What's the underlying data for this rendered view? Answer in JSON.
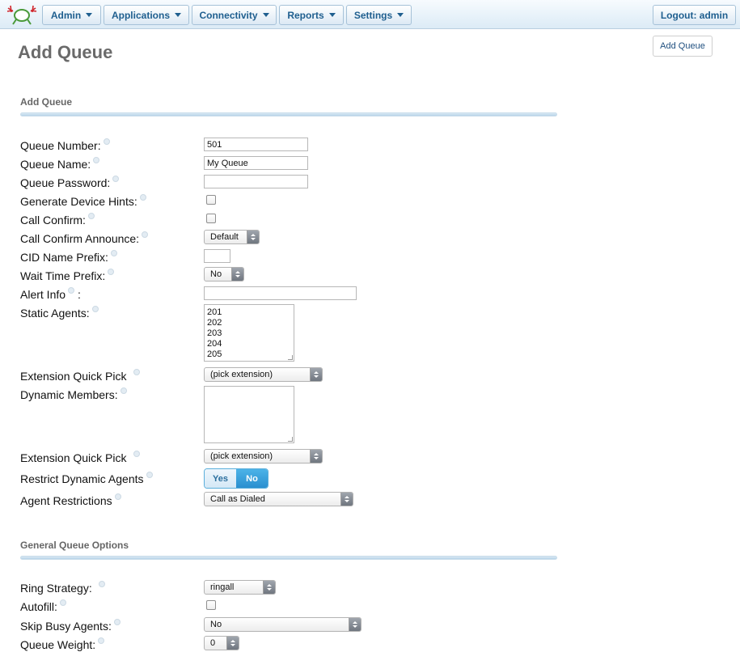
{
  "nav": {
    "menus": [
      "Admin",
      "Applications",
      "Connectivity",
      "Reports",
      "Settings"
    ],
    "logout": "Logout: admin"
  },
  "page": {
    "title": "Add Queue",
    "action_button": "Add Queue"
  },
  "sections": {
    "add_queue": "Add Queue",
    "general_options": "General Queue Options"
  },
  "fields": {
    "queue_number": {
      "label": "Queue Number:",
      "value": "501"
    },
    "queue_name": {
      "label": "Queue Name:",
      "value": "My Queue"
    },
    "queue_password": {
      "label": "Queue Password:",
      "value": ""
    },
    "device_hints": {
      "label": "Generate Device Hints:"
    },
    "call_confirm": {
      "label": "Call Confirm:"
    },
    "call_confirm_announce": {
      "label": "Call Confirm Announce:",
      "value": "Default"
    },
    "cid_prefix": {
      "label": "CID Name Prefix:",
      "value": ""
    },
    "wait_time_prefix": {
      "label": "Wait Time Prefix:",
      "value": "No"
    },
    "alert_info": {
      "label": "Alert Info",
      "suffix": ":",
      "value": ""
    },
    "static_agents": {
      "label": "Static Agents:",
      "value": "201\n202\n203\n204\n205"
    },
    "ext_quick_pick_1": {
      "label": "Extension Quick Pick",
      "value": "(pick extension)"
    },
    "dynamic_members": {
      "label": "Dynamic Members:",
      "value": ""
    },
    "ext_quick_pick_2": {
      "label": "Extension Quick Pick",
      "value": "(pick extension)"
    },
    "restrict_dynamic": {
      "label": "Restrict Dynamic Agents",
      "yes": "Yes",
      "no": "No",
      "selected": "No"
    },
    "agent_restrictions": {
      "label": "Agent Restrictions",
      "value": "Call as Dialed"
    },
    "ring_strategy": {
      "label": "Ring Strategy:",
      "value": "ringall"
    },
    "autofill": {
      "label": "Autofill:"
    },
    "skip_busy": {
      "label": "Skip Busy Agents:",
      "value": "No"
    },
    "queue_weight": {
      "label": "Queue Weight:",
      "value": "0"
    }
  },
  "colors": {
    "nav_text": "#1f5f8f",
    "toggle_active": "#2a8fcf",
    "title_grey": "#6a6a6a"
  }
}
